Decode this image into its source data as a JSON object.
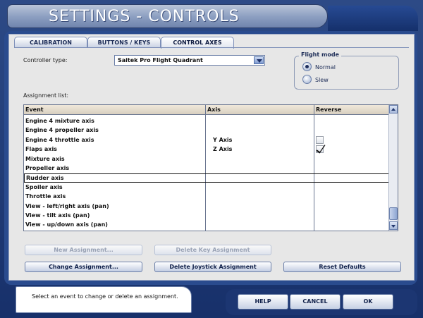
{
  "window": {
    "title": "SETTINGS - CONTROLS"
  },
  "tabs": [
    {
      "label": "CALIBRATION",
      "active": false
    },
    {
      "label": "BUTTONS / KEYS",
      "active": false
    },
    {
      "label": "CONTROL AXES",
      "active": true
    }
  ],
  "controller": {
    "label": "Controller type:",
    "value": "Saitek Pro Flight Quadrant"
  },
  "flight_mode": {
    "title": "Flight mode",
    "options": [
      {
        "label": "Normal",
        "selected": true
      },
      {
        "label": "Slew",
        "selected": false
      }
    ]
  },
  "assignment": {
    "label": "Assignment list:",
    "headers": {
      "event": "Event",
      "axis": "Axis",
      "reverse": "Reverse"
    },
    "rows": [
      {
        "event": "Engine 4 mixture axis",
        "axis": "",
        "reverse": null
      },
      {
        "event": "Engine 4 propeller axis",
        "axis": "",
        "reverse": null
      },
      {
        "event": "Engine 4 throttle axis",
        "axis": "Y Axis",
        "reverse": false
      },
      {
        "event": "Flaps axis",
        "axis": "Z Axis",
        "reverse": true
      },
      {
        "event": "Mixture axis",
        "axis": "",
        "reverse": null
      },
      {
        "event": "Propeller axis",
        "axis": "",
        "reverse": null
      },
      {
        "event": "Rudder axis",
        "axis": "",
        "reverse": null,
        "selected": true
      },
      {
        "event": "Spoiler axis",
        "axis": "",
        "reverse": null
      },
      {
        "event": "Throttle axis",
        "axis": "",
        "reverse": null
      },
      {
        "event": "View - left/right axis (pan)",
        "axis": "",
        "reverse": null
      },
      {
        "event": "View - tilt axis (pan)",
        "axis": "",
        "reverse": null
      },
      {
        "event": "View - up/down axis (pan)",
        "axis": "",
        "reverse": null
      }
    ]
  },
  "buttons": {
    "new_assignment": "New Assignment...",
    "delete_key": "Delete Key Assignment",
    "change_assignment": "Change Assignment...",
    "delete_joystick": "Delete Joystick Assignment",
    "reset_defaults": "Reset Defaults"
  },
  "status": {
    "text": "Select an event to change or delete an assignment."
  },
  "footer": {
    "help": "HELP",
    "cancel": "CANCEL",
    "ok": "OK"
  },
  "colors": {
    "frame": "#2a4b8e",
    "panel": "#e7e7e7",
    "header": "#e4dccd"
  }
}
